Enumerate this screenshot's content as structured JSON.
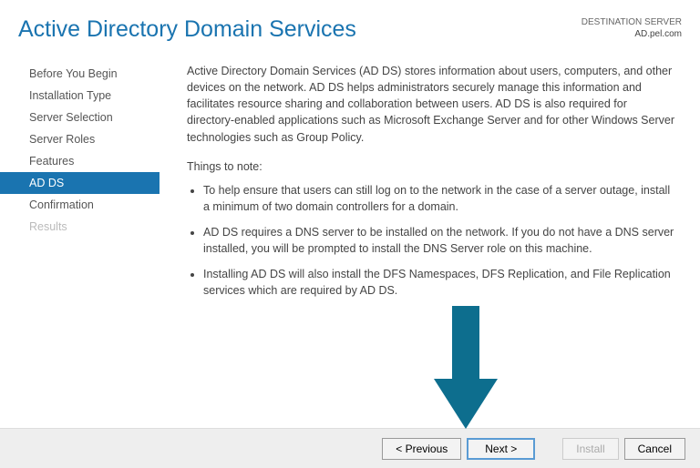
{
  "header": {
    "title": "Active Directory Domain Services",
    "dest_label": "DESTINATION SERVER",
    "dest_server": "AD.pel.com"
  },
  "sidebar": {
    "items": [
      {
        "label": "Before You Begin",
        "state": "normal"
      },
      {
        "label": "Installation Type",
        "state": "normal"
      },
      {
        "label": "Server Selection",
        "state": "normal"
      },
      {
        "label": "Server Roles",
        "state": "normal"
      },
      {
        "label": "Features",
        "state": "normal"
      },
      {
        "label": "AD DS",
        "state": "selected"
      },
      {
        "label": "Confirmation",
        "state": "normal"
      },
      {
        "label": "Results",
        "state": "disabled"
      }
    ]
  },
  "content": {
    "intro": "Active Directory Domain Services (AD DS) stores information about users, computers, and other devices on the network.  AD DS helps administrators securely manage this information and facilitates resource sharing and collaboration between users.  AD DS is also required for directory-enabled applications such as Microsoft Exchange Server and for other Windows Server technologies such as Group Policy.",
    "notes_heading": "Things to note:",
    "notes": [
      "To help ensure that users can still log on to the network in the case of a server outage, install a minimum of two domain controllers for a domain.",
      "AD DS requires a DNS server to be installed on the network.  If you do not have a DNS server installed, you will be prompted to install the DNS Server role on this machine.",
      "Installing AD DS will also install the DFS Namespaces, DFS Replication, and File Replication services which are required by AD DS."
    ]
  },
  "footer": {
    "previous": "< Previous",
    "next": "Next >",
    "install": "Install",
    "cancel": "Cancel"
  },
  "annotation": {
    "arrow_color": "#0d6e8e"
  }
}
